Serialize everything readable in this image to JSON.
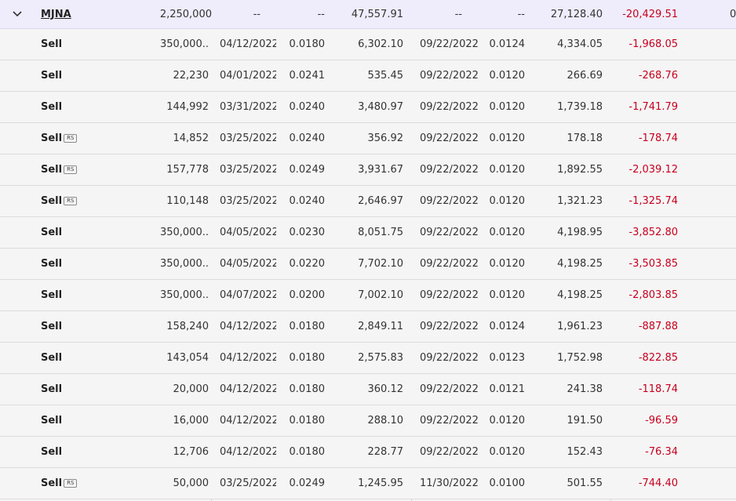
{
  "header": {
    "symbol": "MJNA",
    "quantity": "2,250,000",
    "date_acquired": "--",
    "cost_per_share": "--",
    "cost_basis": "47,557.91",
    "date_sold": "--",
    "proceeds_per_share": "--",
    "proceeds": "27,128.40",
    "gain_loss": "-20,429.51",
    "extra": "0"
  },
  "rows": [
    {
      "action": "Sell",
      "badge": "",
      "quantity": "350,000..",
      "date_acquired": "04/12/2022",
      "cost_per_share": "0.0180",
      "cost_basis": "6,302.10",
      "date_sold": "09/22/2022",
      "proceeds_per_share": "0.0124",
      "proceeds": "4,334.05",
      "gain_loss": "-1,968.05"
    },
    {
      "action": "Sell",
      "badge": "",
      "quantity": "22,230",
      "date_acquired": "04/01/2022",
      "cost_per_share": "0.0241",
      "cost_basis": "535.45",
      "date_sold": "09/22/2022",
      "proceeds_per_share": "0.0120",
      "proceeds": "266.69",
      "gain_loss": "-268.76"
    },
    {
      "action": "Sell",
      "badge": "",
      "quantity": "144,992",
      "date_acquired": "03/31/2022",
      "cost_per_share": "0.0240",
      "cost_basis": "3,480.97",
      "date_sold": "09/22/2022",
      "proceeds_per_share": "0.0120",
      "proceeds": "1,739.18",
      "gain_loss": "-1,741.79"
    },
    {
      "action": "Sell",
      "badge": "RS",
      "quantity": "14,852",
      "date_acquired": "03/25/2022",
      "cost_per_share": "0.0240",
      "cost_basis": "356.92",
      "date_sold": "09/22/2022",
      "proceeds_per_share": "0.0120",
      "proceeds": "178.18",
      "gain_loss": "-178.74"
    },
    {
      "action": "Sell",
      "badge": "RS",
      "quantity": "157,778",
      "date_acquired": "03/25/2022",
      "cost_per_share": "0.0249",
      "cost_basis": "3,931.67",
      "date_sold": "09/22/2022",
      "proceeds_per_share": "0.0120",
      "proceeds": "1,892.55",
      "gain_loss": "-2,039.12"
    },
    {
      "action": "Sell",
      "badge": "RS",
      "quantity": "110,148",
      "date_acquired": "03/25/2022",
      "cost_per_share": "0.0240",
      "cost_basis": "2,646.97",
      "date_sold": "09/22/2022",
      "proceeds_per_share": "0.0120",
      "proceeds": "1,321.23",
      "gain_loss": "-1,325.74"
    },
    {
      "action": "Sell",
      "badge": "",
      "quantity": "350,000..",
      "date_acquired": "04/05/2022",
      "cost_per_share": "0.0230",
      "cost_basis": "8,051.75",
      "date_sold": "09/22/2022",
      "proceeds_per_share": "0.0120",
      "proceeds": "4,198.95",
      "gain_loss": "-3,852.80"
    },
    {
      "action": "Sell",
      "badge": "",
      "quantity": "350,000..",
      "date_acquired": "04/05/2022",
      "cost_per_share": "0.0220",
      "cost_basis": "7,702.10",
      "date_sold": "09/22/2022",
      "proceeds_per_share": "0.0120",
      "proceeds": "4,198.25",
      "gain_loss": "-3,503.85"
    },
    {
      "action": "Sell",
      "badge": "",
      "quantity": "350,000..",
      "date_acquired": "04/07/2022",
      "cost_per_share": "0.0200",
      "cost_basis": "7,002.10",
      "date_sold": "09/22/2022",
      "proceeds_per_share": "0.0120",
      "proceeds": "4,198.25",
      "gain_loss": "-2,803.85"
    },
    {
      "action": "Sell",
      "badge": "",
      "quantity": "158,240",
      "date_acquired": "04/12/2022",
      "cost_per_share": "0.0180",
      "cost_basis": "2,849.11",
      "date_sold": "09/22/2022",
      "proceeds_per_share": "0.0124",
      "proceeds": "1,961.23",
      "gain_loss": "-887.88"
    },
    {
      "action": "Sell",
      "badge": "",
      "quantity": "143,054",
      "date_acquired": "04/12/2022",
      "cost_per_share": "0.0180",
      "cost_basis": "2,575.83",
      "date_sold": "09/22/2022",
      "proceeds_per_share": "0.0123",
      "proceeds": "1,752.98",
      "gain_loss": "-822.85"
    },
    {
      "action": "Sell",
      "badge": "",
      "quantity": "20,000",
      "date_acquired": "04/12/2022",
      "cost_per_share": "0.0180",
      "cost_basis": "360.12",
      "date_sold": "09/22/2022",
      "proceeds_per_share": "0.0121",
      "proceeds": "241.38",
      "gain_loss": "-118.74"
    },
    {
      "action": "Sell",
      "badge": "",
      "quantity": "16,000",
      "date_acquired": "04/12/2022",
      "cost_per_share": "0.0180",
      "cost_basis": "288.10",
      "date_sold": "09/22/2022",
      "proceeds_per_share": "0.0120",
      "proceeds": "191.50",
      "gain_loss": "-96.59"
    },
    {
      "action": "Sell",
      "badge": "",
      "quantity": "12,706",
      "date_acquired": "04/12/2022",
      "cost_per_share": "0.0180",
      "cost_basis": "228.77",
      "date_sold": "09/22/2022",
      "proceeds_per_share": "0.0120",
      "proceeds": "152.43",
      "gain_loss": "-76.34"
    },
    {
      "action": "Sell",
      "badge": "RS",
      "quantity": "50,000",
      "date_acquired": "03/25/2022",
      "cost_per_share": "0.0249",
      "cost_basis": "1,245.95",
      "date_sold": "11/30/2022",
      "proceeds_per_share": "0.0100",
      "proceeds": "501.55",
      "gain_loss": "-744.40"
    }
  ],
  "icons": {
    "expand": "chevron-down-icon",
    "badge": "rs-badge"
  },
  "colors": {
    "negative": "#c8001e",
    "header_bg": "#efedfb",
    "row_bg": "#f5f5f5"
  }
}
